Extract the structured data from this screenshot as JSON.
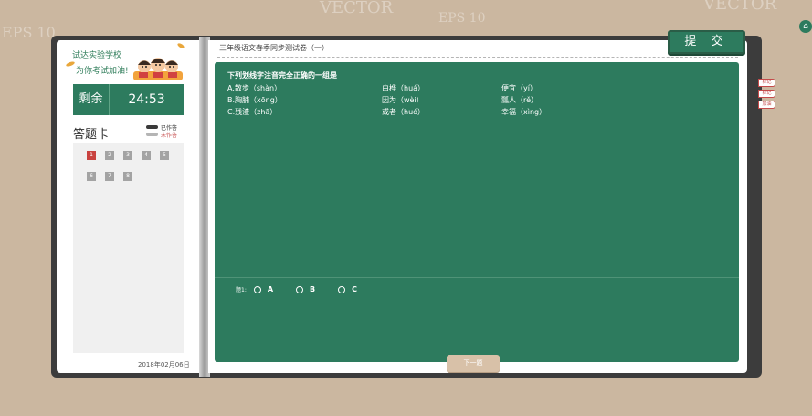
{
  "exam": {
    "school": "试达实验学校",
    "cheer": "为你考试加油!",
    "remaining_label": "剩余",
    "time_left": "24:53",
    "paper_title": "三年级语文春季同步测试卷（一）",
    "submit_label": "提 交",
    "date": "2018年02月06日"
  },
  "answer_card": {
    "title": "答题卡",
    "legend_done": "已作答",
    "legend_undone": "未作答",
    "questions": [
      "1",
      "2",
      "3",
      "4",
      "5",
      "6",
      "7",
      "8"
    ]
  },
  "question": {
    "stem": "下列划线字注音完全正确的一组是",
    "rows": [
      [
        "A.散步（shàn）",
        "白桦（huá）",
        "便宜（yí）"
      ],
      [
        "B.胸脯（xōng）",
        "因为（wèi）",
        "瓢人（rě）"
      ],
      [
        "C.残渣（zhā）",
        "或者（huó）",
        "幸福（xìng）"
      ]
    ],
    "answer_label": "题1:",
    "choices": [
      "A",
      "B",
      "C"
    ],
    "next_label": "下一题"
  },
  "side_tabs": [
    "标记",
    "标记",
    "加油"
  ],
  "colors": {
    "background": "#cbb7a0",
    "primary_green": "#2d7b5e",
    "current_question": "#c9423f",
    "unanswered": "#a3a3a3"
  },
  "icons": {
    "home": "home-icon",
    "mascot": "students-mascot-icon"
  }
}
